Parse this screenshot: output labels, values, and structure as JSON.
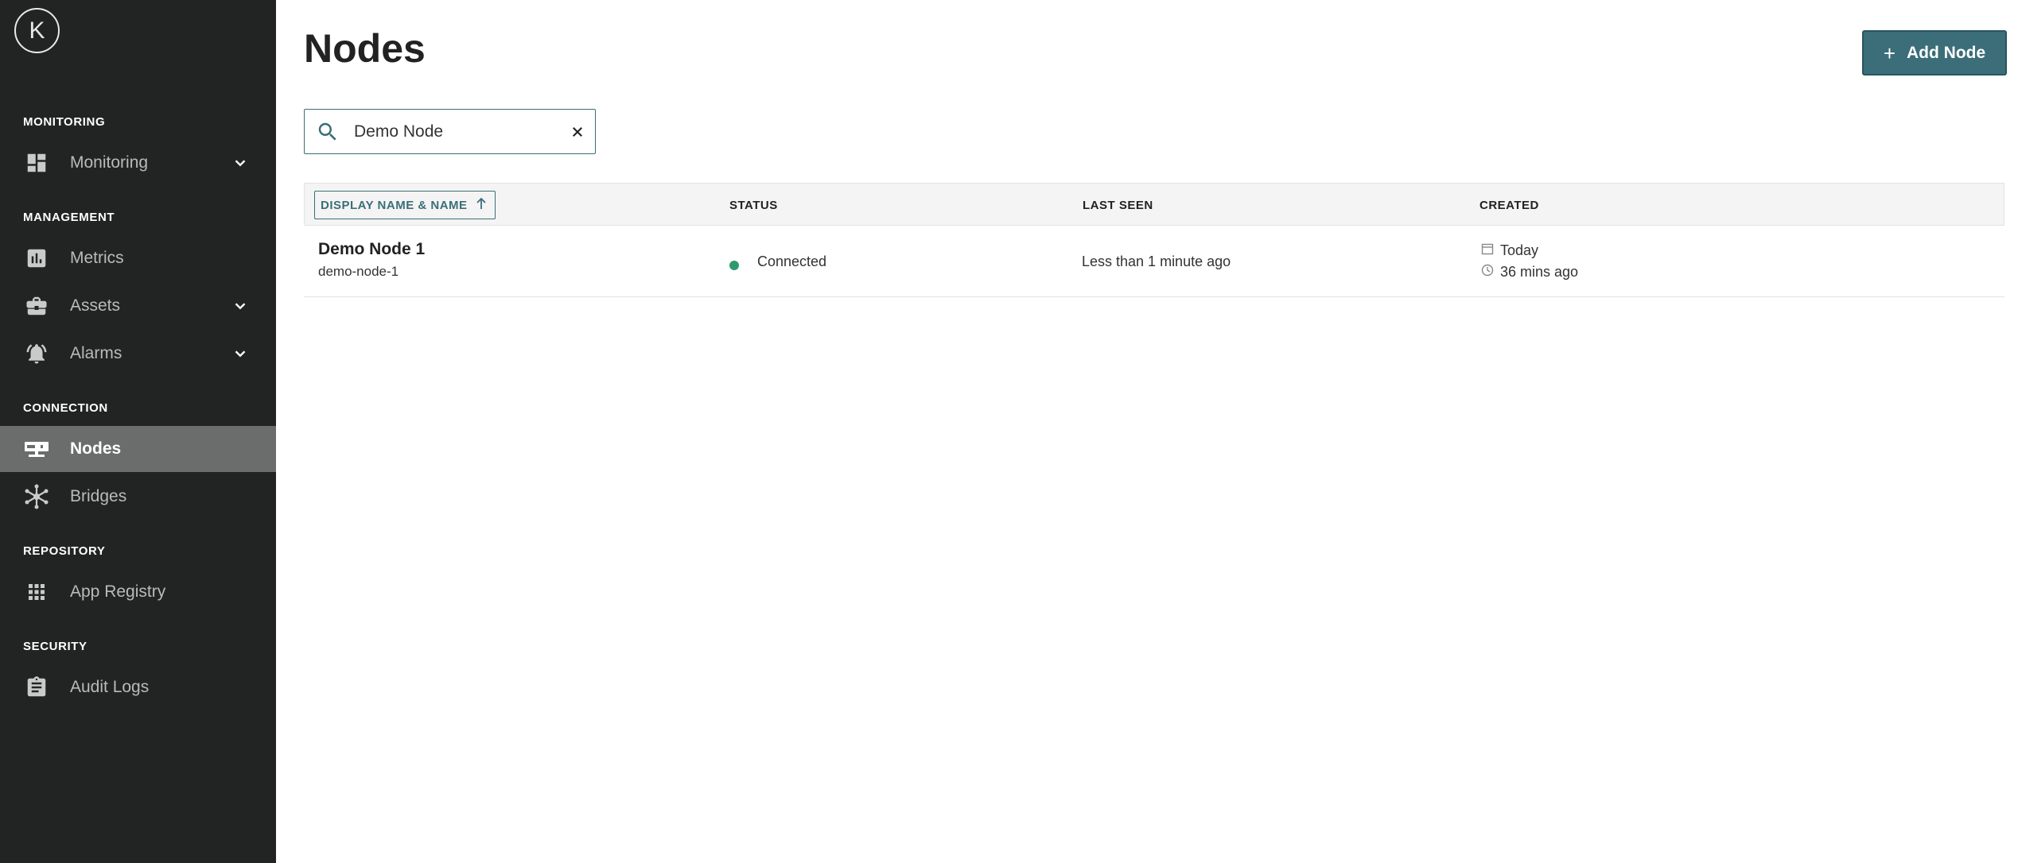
{
  "logo": {
    "letter": "K"
  },
  "sidebar": {
    "sections": [
      {
        "label": "MONITORING"
      },
      {
        "label": "MANAGEMENT"
      },
      {
        "label": "CONNECTION"
      },
      {
        "label": "REPOSITORY"
      },
      {
        "label": "SECURITY"
      }
    ],
    "items": [
      {
        "label": "Monitoring",
        "icon": "dashboard-icon",
        "expandable": true
      },
      {
        "label": "Metrics",
        "icon": "bar-chart-icon",
        "expandable": false
      },
      {
        "label": "Assets",
        "icon": "briefcase-icon",
        "expandable": true
      },
      {
        "label": "Alarms",
        "icon": "bell-icon",
        "expandable": true
      },
      {
        "label": "Nodes",
        "icon": "node-icon",
        "expandable": false,
        "active": true
      },
      {
        "label": "Bridges",
        "icon": "bridge-icon",
        "expandable": false
      },
      {
        "label": "App Registry",
        "icon": "grid-icon",
        "expandable": false
      },
      {
        "label": "Audit Logs",
        "icon": "clipboard-icon",
        "expandable": false
      }
    ]
  },
  "header": {
    "title": "Nodes",
    "add_button_label": "Add Node"
  },
  "search": {
    "value": "Demo Node"
  },
  "table": {
    "columns": [
      {
        "label": "DISPLAY NAME & NAME",
        "sorted": "ascending"
      },
      {
        "label": "STATUS"
      },
      {
        "label": "LAST SEEN"
      },
      {
        "label": "CREATED"
      }
    ],
    "rows": [
      {
        "display_name": "Demo Node 1",
        "name": "demo-node-1",
        "status": "Connected",
        "last_seen": "Less than 1 minute ago",
        "created_date": "Today",
        "created_time": "36 mins ago"
      }
    ]
  },
  "colors": {
    "sidebar_bg": "#222423",
    "sidebar_active": "#6b6c6c",
    "accent": "#3b6e78",
    "status_connected": "#2e9a6b"
  }
}
